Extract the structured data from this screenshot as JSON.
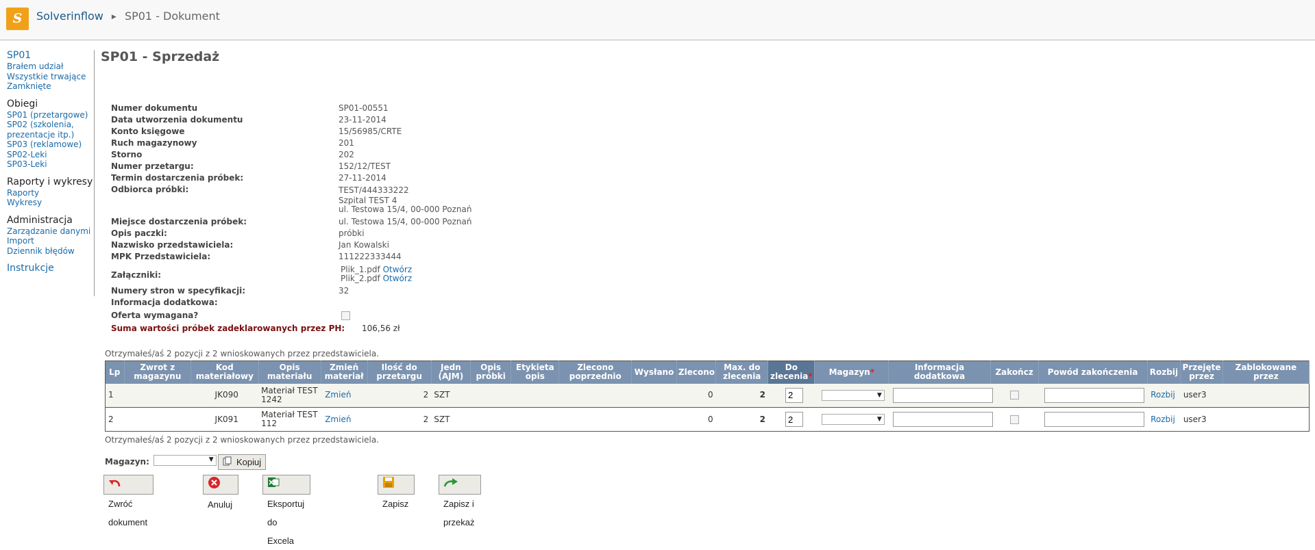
{
  "header": {
    "app_name": "Solverinflow",
    "page_crumb": "SP01 - Dokument",
    "logo_letter": "S"
  },
  "sidebar": {
    "groups": [
      {
        "title": "SP01",
        "items": [
          "Brałem udział",
          "Wszystkie trwające",
          "Zamknięte"
        ]
      },
      {
        "title": "Obiegi",
        "items": [
          "SP01 (przetargowe)",
          "SP02 (szkolenia,",
          "prezentacje itp.)",
          "SP03 (reklamowe)",
          "SP02-Leki",
          "SP03-Leki"
        ]
      },
      {
        "title": "Raporty i wykresy",
        "items": [
          "Raporty",
          "Wykresy"
        ]
      },
      {
        "title": "Administracja",
        "items": [
          "Zarządzanie danymi",
          "Import",
          "Dziennik błędów"
        ]
      },
      {
        "title": "Instrukcje",
        "items": []
      }
    ]
  },
  "page": {
    "title": "SP01 - Sprzedaż"
  },
  "fields": {
    "numer_dokumentu": {
      "label": "Numer dokumentu",
      "value": "SP01-00551"
    },
    "data_utworzenia": {
      "label": "Data utworzenia dokumentu",
      "value": "23-11-2014"
    },
    "konto": {
      "label": "Konto księgowe",
      "value": "15/56985/CRTE"
    },
    "ruch": {
      "label": "Ruch magazynowy",
      "value": "201"
    },
    "storno": {
      "label": "Storno",
      "value": "202"
    },
    "numer_przetargu": {
      "label": "Numer przetargu:",
      "value": "152/12/TEST"
    },
    "termin": {
      "label": "Termin dostarczenia próbek:",
      "value": "27-11-2014"
    },
    "odbiorca": {
      "label": "Odbiorca próbki:",
      "value": "TEST/444333222",
      "line2": "Szpital TEST 4",
      "line3": "ul. Testowa 15/4, 00-000 Poznań"
    },
    "miejsce": {
      "label": "Miejsce dostarczenia próbek:",
      "value": "ul. Testowa 15/4, 00-000 Poznań"
    },
    "opis_paczki": {
      "label": "Opis paczki:",
      "value": "próbki"
    },
    "nazwisko": {
      "label": "Nazwisko przedstawiciela:",
      "value": "Jan Kowalski"
    },
    "mpk": {
      "label": "MPK Przedstawiciela:",
      "value": "111222333444"
    },
    "zalaczniki": {
      "label": "Załączniki:",
      "file1": "Plik_1.pdf",
      "file2": "Plik_2.pdf",
      "open": "Otwórz"
    },
    "numery_stron": {
      "label": "Numery stron w specyfikacji:",
      "value": "32"
    },
    "informacja": {
      "label": "Informacja dodatkowa:",
      "value": ""
    },
    "oferta": {
      "label": "Oferta wymagana?",
      "checked": false
    },
    "suma": {
      "label": "Suma wartości próbek zadeklarowanych przez PH:",
      "value": "106,56 zł"
    }
  },
  "note_text": "Otrzymałeś/aś 2 pozycji z 2 wnioskowanych przez przedstawiciela.",
  "table": {
    "headers": {
      "lp": "Lp",
      "zwrot_1": "Zwrot z",
      "zwrot_2": "magazynu",
      "kod_1": "Kod",
      "kod_2": "materiałowy",
      "opis_1": "Opis",
      "opis_2": "materiału",
      "zmien_1": "Zmień",
      "zmien_2": "materiał",
      "ilosc_1": "Ilość do",
      "ilosc_2": "przetargu",
      "jedn_1": "Jedn",
      "jedn_2": "(AJM)",
      "opisp_1": "Opis",
      "opisp_2": "próbki",
      "etyk_1": "Etykieta",
      "etyk_2": "opis",
      "zlec_1": "Zlecono",
      "zlec_2": "poprzednio",
      "wyslano": "Wysłano",
      "zlecono": "Zlecono",
      "max_1": "Max. do",
      "max_2": "zlecenia",
      "do_1": "Do",
      "do_2": "zlecenia",
      "magazyn": "Magazyn",
      "info_1": "Informacja",
      "info_2": "dodatkowa",
      "zakoncz": "Zakończ",
      "powod": "Powód zakończenia",
      "rozbij": "Rozbij",
      "przejete_1": "Przejęte",
      "przejete_2": "przez",
      "zablok_1": "Zablokowane",
      "zablok_2": "przez"
    },
    "rows": [
      {
        "lp": "1",
        "kod": "JK090",
        "opis_1": "Materiał TEST",
        "opis_2": "1242",
        "zmien": "Zmień",
        "ilosc": "2",
        "jedn": "SZT",
        "zlecono": "0",
        "max": "2",
        "do_zlecenia": "2",
        "rozbij": "Rozbij",
        "przejete": "user3"
      },
      {
        "lp": "2",
        "kod": "JK091",
        "opis_1": "Materiał TEST",
        "opis_2": "112",
        "zmien": "Zmień",
        "ilosc": "2",
        "jedn": "SZT",
        "zlecono": "0",
        "max": "2",
        "do_zlecenia": "2",
        "rozbij": "Rozbij",
        "przejete": "user3"
      }
    ]
  },
  "magazyn_label": "Magazyn:",
  "buttons": {
    "kopiuj": "Kopiuj",
    "zwroc": "Zwróć dokument",
    "anuluj": "Anuluj",
    "eksportuj": "Eksportuj do Excela",
    "zapisz": "Zapisz",
    "zapisz_przekaz": "Zapisz i przekaż"
  },
  "colors": {
    "accent_logo": "#f1a118",
    "link": "#1a6aa8",
    "table_header": "#7b93b0",
    "table_header_dark": "#5a7696",
    "sum_label": "#7a1010"
  }
}
